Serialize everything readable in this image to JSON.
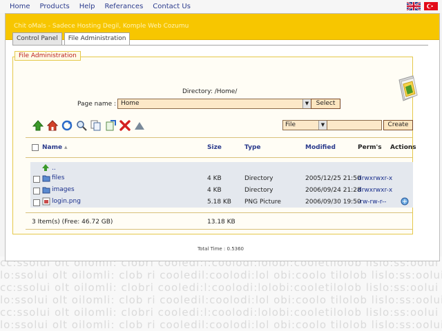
{
  "nav": {
    "items": [
      "Home",
      "Products",
      "Help",
      "Referances",
      "Contact Us"
    ]
  },
  "header": {
    "title": "Chit oMals - Sadece Hosting Degil, Komple Web Cozumu"
  },
  "tabs": [
    {
      "label": "Control Panel"
    },
    {
      "label": "File Administration"
    }
  ],
  "panel": {
    "legend": "File Administration"
  },
  "directory": {
    "label": "Directory: /Home/"
  },
  "page": {
    "label": "Page name :",
    "selected": "Home",
    "select_button": "Select"
  },
  "create": {
    "type_selected": "File",
    "name_value": "",
    "button": "Create"
  },
  "table": {
    "headers": {
      "name": "Name",
      "size": "Size",
      "type": "Type",
      "modified": "Modified",
      "perms": "Perm's",
      "actions": "Actions"
    },
    "up_label": "..",
    "rows": [
      {
        "name": "files",
        "size": "4 KB",
        "type": "Directory",
        "modified": "2005/12/25 21:50",
        "perms": "drwxrwxr-x"
      },
      {
        "name": "images",
        "size": "4 KB",
        "type": "Directory",
        "modified": "2006/09/24 21:28",
        "perms": "drwxrwxr-x"
      },
      {
        "name": "login.png",
        "size": "5.18 KB",
        "type": "PNG Picture",
        "modified": "2006/09/30 19:50",
        "perms": "-rw-rw-r--"
      }
    ],
    "summary": "3 Item(s) (Free: 46.72 GB)",
    "total_size": "13.18 KB"
  },
  "footer": {
    "text": "Total Time : 0.5360"
  },
  "colors": {
    "header": "#f7c600",
    "link": "#2a3a8c",
    "accent_red": "#b22222"
  },
  "icons": [
    "up-arrow-icon",
    "home-icon",
    "refresh-icon",
    "search-icon",
    "copy-icon",
    "move-icon",
    "delete-icon",
    "up-dir-icon",
    "folder-icon",
    "image-file-icon",
    "view-icon"
  ]
}
